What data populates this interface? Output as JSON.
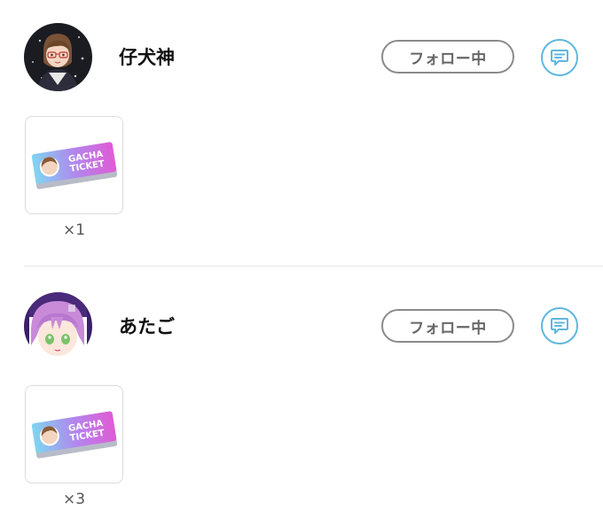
{
  "gift_list": [
    {
      "username": "仔犬神",
      "follow_label": "フォロー中",
      "message_icon": "chat-bubble-icon",
      "item": {
        "icon": "gacha-ticket-icon",
        "ticket_text_line1": "GACHA",
        "ticket_text_line2": "TICKET",
        "quantity": "×1"
      }
    },
    {
      "username": "あたご",
      "follow_label": "フォロー中",
      "message_icon": "chat-bubble-icon",
      "item": {
        "icon": "gacha-ticket-icon",
        "ticket_text_line1": "GACHA",
        "ticket_text_line2": "TICKET",
        "quantity": "×3"
      }
    }
  ],
  "colors": {
    "accent": "#5fb7e0",
    "follow_border": "#8a8a8a",
    "ticket_gradient_start": "#7fd6f0",
    "ticket_gradient_end": "#e05bd6"
  }
}
